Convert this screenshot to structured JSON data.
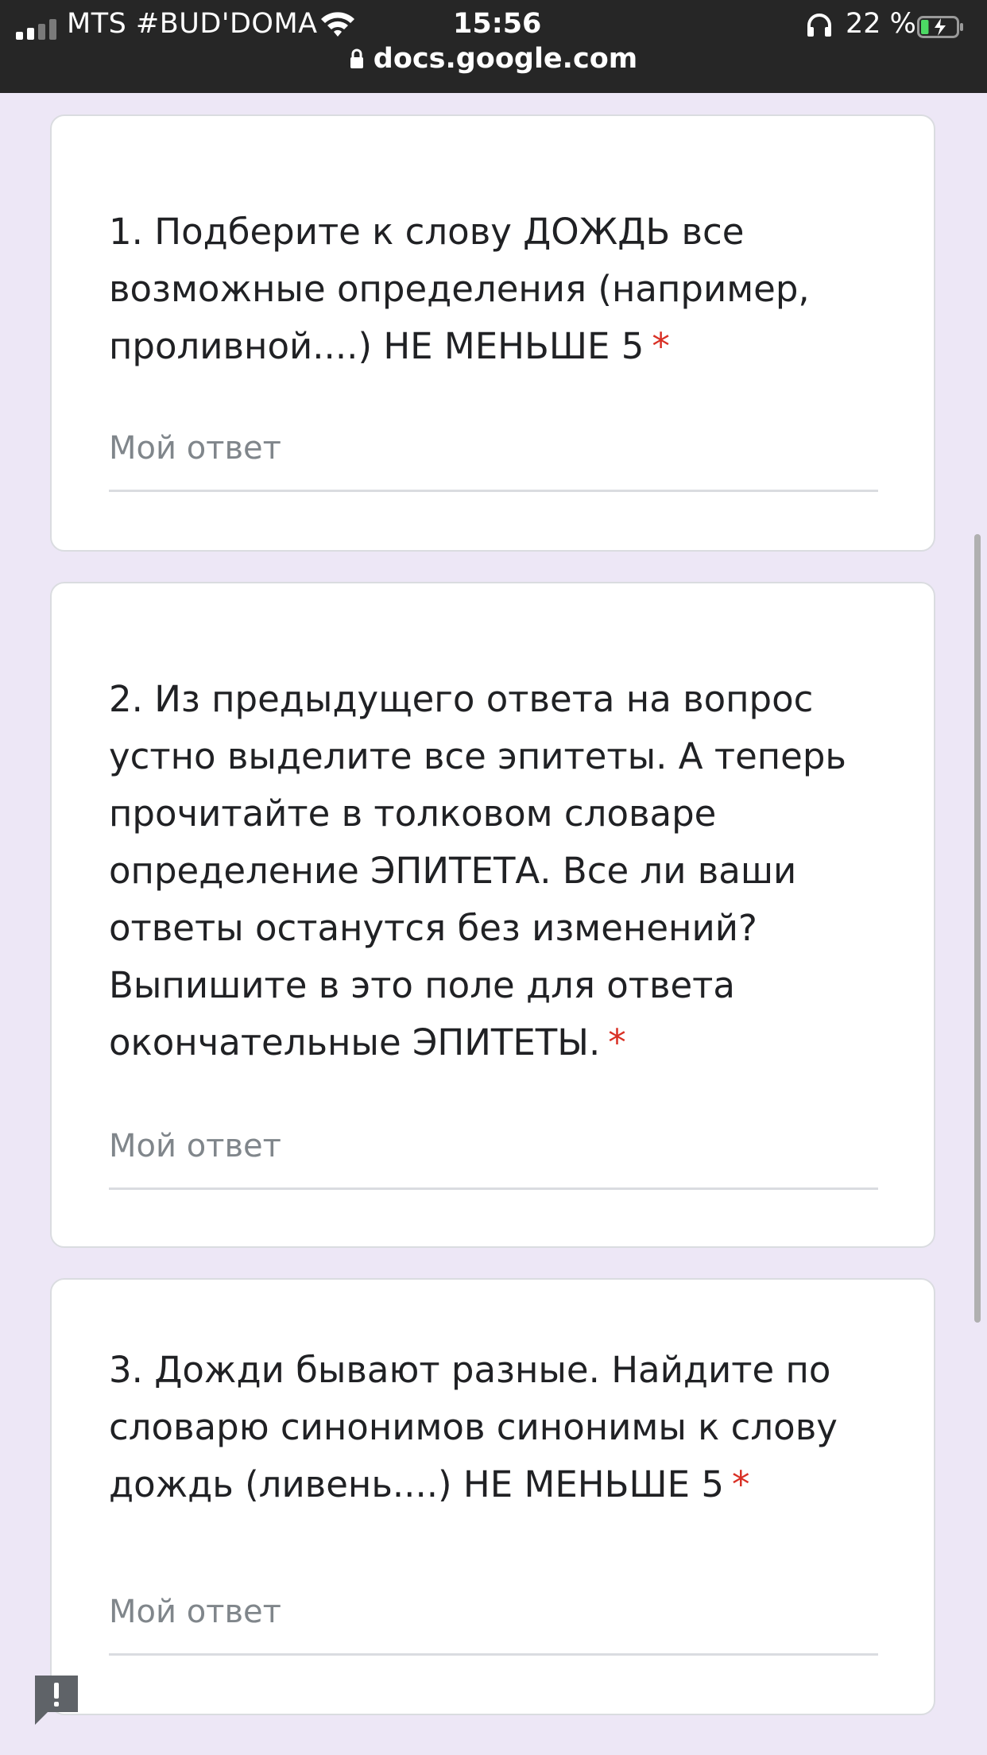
{
  "status_bar": {
    "carrier": "MTS #BUD'DOMA",
    "time": "15:56",
    "battery_percent": "22 %",
    "battery_level": 0.22,
    "url": "docs.google.com"
  },
  "questions": [
    {
      "text": "1. Подберите к слову ДОЖДЬ все возможные определения (например, проливной....) НЕ МЕНЬШЕ 5",
      "required_mark": "*",
      "placeholder": "Мой ответ"
    },
    {
      "text": "2. Из предыдущего ответа на вопрос устно выделите все эпитеты. А теперь прочитайте в толковом словаре определение ЭПИТЕТА. Все ли ваши ответы останутся без изменений? Выпишите в это поле для ответа окончательные ЭПИТЕТЫ.",
      "required_mark": "*",
      "placeholder": "Мой ответ"
    },
    {
      "text": "3. Дожди бывают разные. Найдите по словарю синонимов синонимы к слову дождь (ливень....) НЕ МЕНЬШЕ 5",
      "required_mark": "*",
      "placeholder": "Мой ответ"
    }
  ],
  "colors": {
    "background": "#ede7f6",
    "required": "#d93025",
    "status_bar": "#262626"
  },
  "icons": [
    "signal-icon",
    "wifi-icon",
    "headphones-icon",
    "battery-icon",
    "lock-icon",
    "feedback-icon"
  ]
}
